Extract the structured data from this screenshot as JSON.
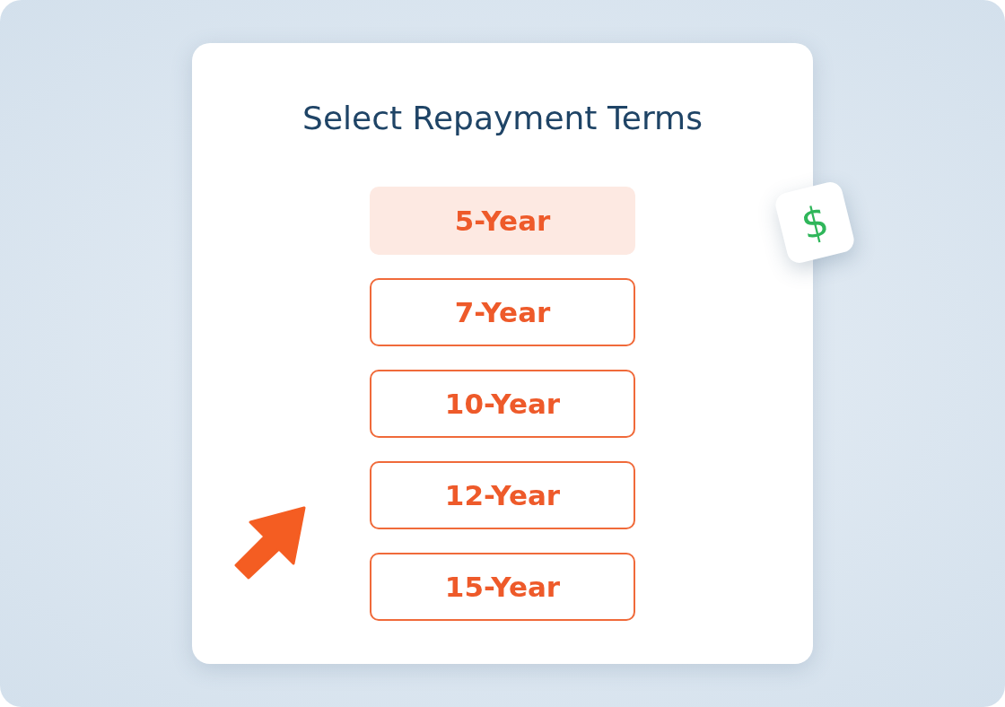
{
  "title": "Select Repayment Terms",
  "options": [
    {
      "label": "5-Year",
      "selected": true
    },
    {
      "label": "7-Year",
      "selected": false
    },
    {
      "label": "10-Year",
      "selected": false
    },
    {
      "label": "12-Year",
      "selected": false
    },
    {
      "label": "15-Year",
      "selected": false
    }
  ],
  "badge": {
    "symbol": "$"
  }
}
